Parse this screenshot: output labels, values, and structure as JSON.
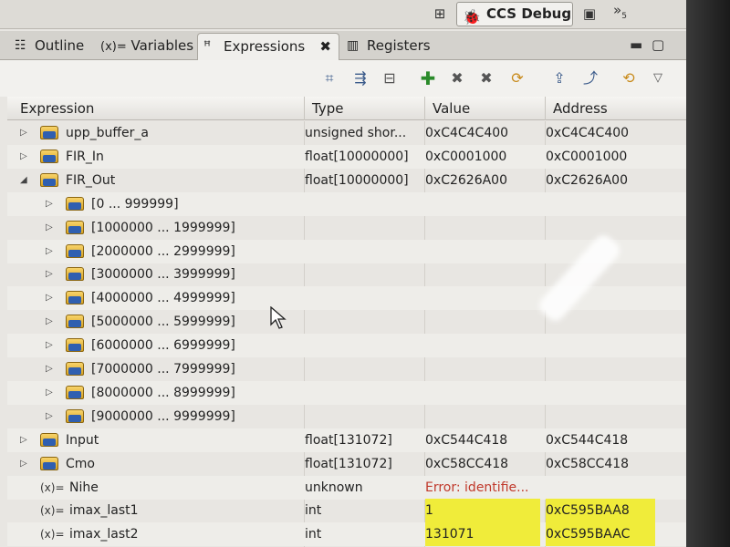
{
  "perspective": {
    "button_label": "CCS Debug",
    "overflow_label": "»",
    "overflow_count": "5"
  },
  "tabs": [
    {
      "label": "Outline",
      "icon": "outline-icon",
      "active": false
    },
    {
      "label": "Variables",
      "icon": "variables-icon",
      "prefix": "(x)=",
      "active": false
    },
    {
      "label": "Expressions",
      "icon": "expressions-icon",
      "active": true
    },
    {
      "label": "Registers",
      "icon": "registers-icon",
      "active": false
    }
  ],
  "columns": {
    "expression": "Expression",
    "type": "Type",
    "value": "Value",
    "address": "Address"
  },
  "rows": [
    {
      "name": "upp_buffer_a",
      "type": "unsigned shor...",
      "value": "0xC4C4C400",
      "address": "0xC4C4C400",
      "icon": "array-icon",
      "level": 0,
      "twisty": "collapsed"
    },
    {
      "name": "FIR_In",
      "type": "float[10000000]",
      "value": "0xC0001000",
      "address": "0xC0001000",
      "icon": "array-icon",
      "level": 0,
      "twisty": "collapsed"
    },
    {
      "name": "FIR_Out",
      "type": "float[10000000]",
      "value": "0xC2626A00",
      "address": "0xC2626A00",
      "icon": "array-icon",
      "level": 0,
      "twisty": "expanded"
    },
    {
      "name": "[0 ... 999999]",
      "type": "",
      "value": "",
      "address": "",
      "icon": "array-icon",
      "level": 1,
      "twisty": "collapsed"
    },
    {
      "name": "[1000000 ... 1999999]",
      "type": "",
      "value": "",
      "address": "",
      "icon": "array-icon",
      "level": 1,
      "twisty": "collapsed"
    },
    {
      "name": "[2000000 ... 2999999]",
      "type": "",
      "value": "",
      "address": "",
      "icon": "array-icon",
      "level": 1,
      "twisty": "collapsed"
    },
    {
      "name": "[3000000 ... 3999999]",
      "type": "",
      "value": "",
      "address": "",
      "icon": "array-icon",
      "level": 1,
      "twisty": "collapsed"
    },
    {
      "name": "[4000000 ... 4999999]",
      "type": "",
      "value": "",
      "address": "",
      "icon": "array-icon",
      "level": 1,
      "twisty": "collapsed"
    },
    {
      "name": "[5000000 ... 5999999]",
      "type": "",
      "value": "",
      "address": "",
      "icon": "array-icon",
      "level": 1,
      "twisty": "collapsed"
    },
    {
      "name": "[6000000 ... 6999999]",
      "type": "",
      "value": "",
      "address": "",
      "icon": "array-icon",
      "level": 1,
      "twisty": "collapsed"
    },
    {
      "name": "[7000000 ... 7999999]",
      "type": "",
      "value": "",
      "address": "",
      "icon": "array-icon",
      "level": 1,
      "twisty": "collapsed"
    },
    {
      "name": "[8000000 ... 8999999]",
      "type": "",
      "value": "",
      "address": "",
      "icon": "array-icon",
      "level": 1,
      "twisty": "collapsed"
    },
    {
      "name": "[9000000 ... 9999999]",
      "type": "",
      "value": "",
      "address": "",
      "icon": "array-icon",
      "level": 1,
      "twisty": "collapsed"
    },
    {
      "name": "Input",
      "type": "float[131072]",
      "value": "0xC544C418",
      "address": "0xC544C418",
      "icon": "array-icon",
      "level": 0,
      "twisty": "collapsed"
    },
    {
      "name": "Cmo",
      "type": "float[131072]",
      "value": "0xC58CC418",
      "address": "0xC58CC418",
      "icon": "array-icon",
      "level": 0,
      "twisty": "collapsed"
    },
    {
      "name": "Nihe",
      "type": "unknown",
      "value": "Error: identifie...",
      "address": "",
      "icon": "variable-icon",
      "prefix": "(x)=",
      "level": 0,
      "twisty": "none",
      "error": true
    },
    {
      "name": "imax_last1",
      "type": "int",
      "value": "1",
      "address": "0xC595BAA8",
      "icon": "variable-icon",
      "prefix": "(x)=",
      "level": 0,
      "twisty": "none",
      "highlight": true
    },
    {
      "name": "imax_last2",
      "type": "int",
      "value": "131071",
      "address": "0xC595BAAC",
      "icon": "variable-icon",
      "prefix": "(x)=",
      "level": 0,
      "twisty": "none",
      "highlight": true
    }
  ],
  "colors": {
    "highlight": "#f0ec3a",
    "error": "#c0392b",
    "add_green": "#2a8a2a"
  }
}
